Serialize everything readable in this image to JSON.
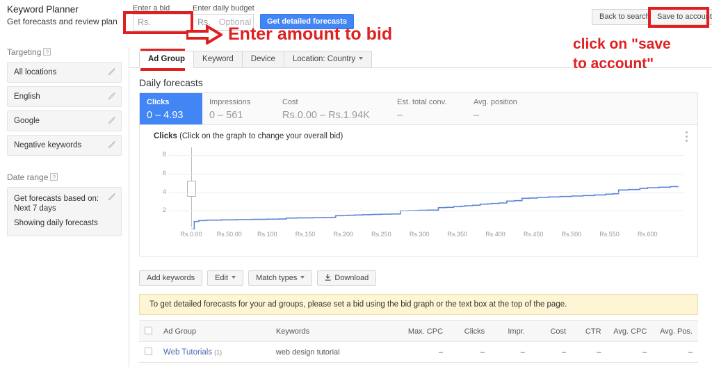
{
  "header": {
    "app_title": "Keyword Planner",
    "app_subtitle": "Get forecasts and review plan",
    "bid_label": "Enter a bid",
    "bid_value": "Rs.",
    "budget_label": "Enter daily budget",
    "budget_currency": "Rs.",
    "budget_placeholder": "Optional",
    "get_forecasts_button": "Get detailed forecasts",
    "back_to_search_button": "Back to search",
    "save_to_account_button": "Save to account"
  },
  "annotations": {
    "enter_amount": "Enter amount to bid",
    "click_save_line1": "click on \"save",
    "click_save_line2": "to account\""
  },
  "sidebar": {
    "targeting_title": "Targeting",
    "help_glyph": "?",
    "targeting_items": [
      {
        "label": "All locations"
      },
      {
        "label": "English"
      },
      {
        "label": "Google"
      },
      {
        "label": "Negative keywords"
      }
    ],
    "date_range_title": "Date range",
    "date_range_line1": "Get forecasts based on: Next 7 days",
    "date_range_line2": "Showing daily forecasts"
  },
  "tabs": [
    {
      "label": "Ad Group",
      "active": true,
      "caret": false
    },
    {
      "label": "Keyword",
      "active": false,
      "caret": false
    },
    {
      "label": "Device",
      "active": false,
      "caret": false
    },
    {
      "label": "Location: Country",
      "active": false,
      "caret": true
    }
  ],
  "forecasts": {
    "section_title": "Daily forecasts",
    "metrics": [
      {
        "label": "Clicks",
        "value": "0 – 4.93",
        "selected": true
      },
      {
        "label": "Impressions",
        "value": "0 – 561",
        "selected": false
      },
      {
        "label": "Cost",
        "value": "Rs.0.00 – Rs.1.94K",
        "selected": false
      },
      {
        "label": "Est. total conv.",
        "value": "–",
        "selected": false
      },
      {
        "label": "Avg. position",
        "value": "–",
        "selected": false
      }
    ]
  },
  "chart_data": {
    "type": "line",
    "title": "Clicks",
    "title_suffix": "(Click on the graph to change your overall bid)",
    "xlabel": "",
    "ylabel": "Clicks",
    "grid": true,
    "legend": "none",
    "xlim": [
      0,
      640
    ],
    "ylim": [
      0,
      9
    ],
    "yticks": [
      2,
      4,
      6,
      8
    ],
    "xticks": [
      0,
      50,
      100,
      150,
      200,
      250,
      300,
      350,
      400,
      450,
      500,
      550,
      600
    ],
    "xtick_labels": [
      "Rs.0.00",
      "Rs.50.00",
      "Rs.100",
      "Rs.150",
      "Rs.200",
      "Rs.250",
      "Rs.300",
      "Rs.350",
      "Rs.400",
      "Rs.450",
      "Rs.500",
      "Rs.550",
      "Rs.600"
    ],
    "bid_marker": {
      "x": 0,
      "y": 4.4,
      "style": "vertical-slider"
    },
    "series": [
      {
        "name": "Clicks",
        "x": [
          0,
          4,
          10,
          20,
          40,
          60,
          80,
          100,
          115,
          125,
          140,
          160,
          175,
          185,
          190,
          200,
          205,
          215,
          225,
          235,
          240,
          250,
          262,
          275,
          285,
          295,
          300,
          310,
          325,
          335,
          345,
          355,
          360,
          370,
          380,
          390,
          395,
          405,
          415,
          425,
          435,
          445,
          455,
          470,
          485,
          500,
          515,
          530,
          545,
          555,
          562,
          575,
          590,
          600,
          615,
          630,
          640
        ],
        "y": [
          0.0,
          0.85,
          0.95,
          1.0,
          1.03,
          1.06,
          1.08,
          1.1,
          1.12,
          1.22,
          1.24,
          1.26,
          1.28,
          1.3,
          1.48,
          1.5,
          1.52,
          1.55,
          1.58,
          1.6,
          1.62,
          1.64,
          1.66,
          2.0,
          2.02,
          2.04,
          2.06,
          2.08,
          2.35,
          2.38,
          2.45,
          2.5,
          2.55,
          2.6,
          2.72,
          2.75,
          2.8,
          2.85,
          3.05,
          3.1,
          3.35,
          3.38,
          3.45,
          3.5,
          3.55,
          3.6,
          3.65,
          3.72,
          3.8,
          3.85,
          4.25,
          4.3,
          4.42,
          4.5,
          4.55,
          4.62,
          4.65
        ]
      }
    ]
  },
  "table_toolbar": {
    "add_keywords": "Add keywords",
    "edit": "Edit",
    "match_types": "Match types",
    "download": "Download"
  },
  "notice": "To get detailed forecasts for your ad groups, please set a bid using the bid graph or the text box at the top of the page.",
  "table": {
    "columns": [
      "Ad Group",
      "Keywords",
      "Max. CPC",
      "Clicks",
      "Impr.",
      "Cost",
      "CTR",
      "Avg. CPC",
      "Avg. Pos."
    ],
    "rows": [
      {
        "ad_group": "Web Tutorials",
        "ad_group_count": "(1)",
        "keywords": "web design tutorial",
        "max_cpc": "–",
        "clicks": "–",
        "impr": "–",
        "cost": "–",
        "ctr": "–",
        "avg_cpc": "–",
        "avg_pos": "–"
      }
    ]
  },
  "colors": {
    "accent_blue": "#4285f4",
    "annotation_red": "#e02020",
    "notice_yellow": "#fdf5d4",
    "link_blue": "#4a6ab5"
  }
}
